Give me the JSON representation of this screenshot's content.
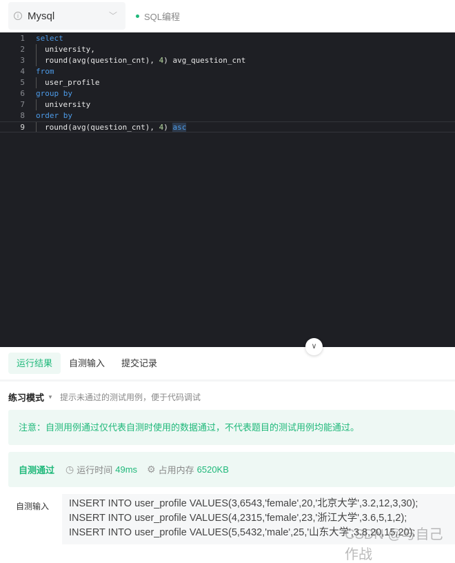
{
  "header": {
    "language": "Mysql",
    "mode": "SQL编程"
  },
  "editor": {
    "lines": [
      {
        "n": "1",
        "parts": [
          {
            "t": "select",
            "c": "kw"
          }
        ],
        "indent": false
      },
      {
        "n": "2",
        "parts": [
          {
            "t": "university,",
            "c": ""
          }
        ],
        "indent": true
      },
      {
        "n": "3",
        "parts": [
          {
            "t": "round(avg(question_cnt), ",
            "c": ""
          },
          {
            "t": "4",
            "c": "num"
          },
          {
            "t": ") avg_question_cnt",
            "c": ""
          }
        ],
        "indent": true
      },
      {
        "n": "4",
        "parts": [
          {
            "t": "from",
            "c": "kw"
          }
        ],
        "indent": false
      },
      {
        "n": "5",
        "parts": [
          {
            "t": "user_profile",
            "c": ""
          }
        ],
        "indent": true
      },
      {
        "n": "6",
        "parts": [
          {
            "t": "group by",
            "c": "kw"
          }
        ],
        "indent": false
      },
      {
        "n": "7",
        "parts": [
          {
            "t": "university",
            "c": ""
          }
        ],
        "indent": true
      },
      {
        "n": "8",
        "parts": [
          {
            "t": "order by",
            "c": "kw"
          }
        ],
        "indent": false
      },
      {
        "n": "9",
        "parts": [
          {
            "t": "round(avg(question_cnt), ",
            "c": ""
          },
          {
            "t": "4",
            "c": "num"
          },
          {
            "t": ") ",
            "c": ""
          },
          {
            "t": "asc",
            "c": "sel"
          }
        ],
        "indent": true,
        "active": true
      }
    ]
  },
  "tabs": [
    {
      "label": "运行结果",
      "active": true
    },
    {
      "label": "自测输入"
    },
    {
      "label": "提交记录"
    }
  ],
  "practice": {
    "mode": "练习模式",
    "hint": "提示未通过的测试用例，便于代码调试"
  },
  "notice": "注意：自测用例通过仅代表自测时使用的数据通过，不代表题目的测试用例均能通过。",
  "result": {
    "status": "自测通过",
    "time_label": "运行时间",
    "time": "49ms",
    "mem_label": "占用内存",
    "mem": "6520KB"
  },
  "self_input": {
    "label": "自测输入",
    "lines": [
      "INSERT INTO user_profile VALUES(3,6543,'female',20,'北京大学',3.2,12,3,30);",
      "INSERT INTO user_profile VALUES(4,2315,'female',23,'浙江大学',3.6,5,1,2);",
      "INSERT INTO user_profile VALUES(5,5432,'male',25,'山东大学',3.8,20,15,20);"
    ]
  },
  "watermark": "CSDN @与自己作战"
}
